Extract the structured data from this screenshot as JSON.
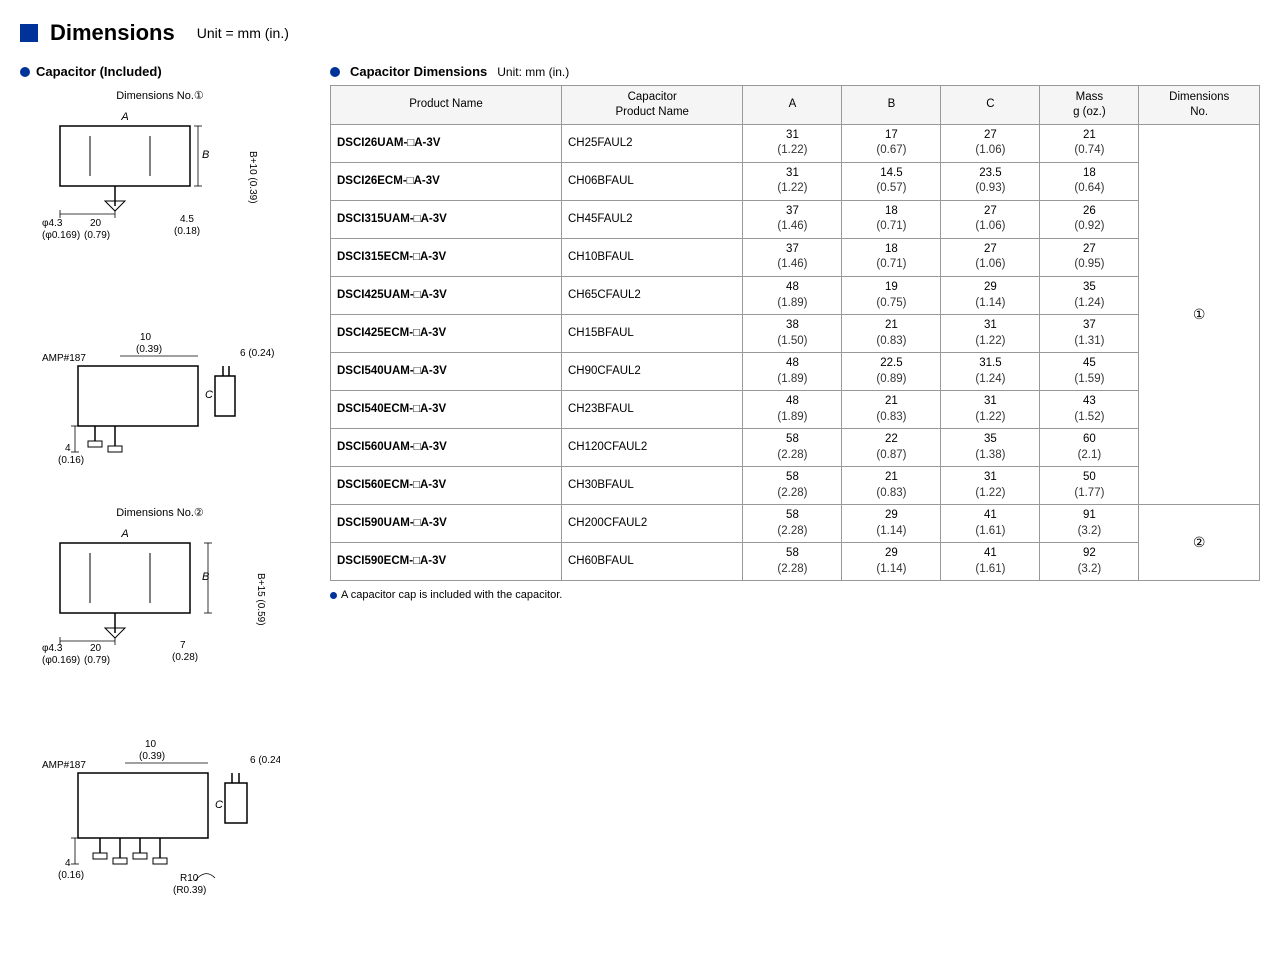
{
  "header": {
    "title": "Dimensions",
    "unit": "Unit = mm (in.)"
  },
  "left": {
    "section_title": "Capacitor (Included)",
    "dim1_label": "Dimensions No.①",
    "dim2_label": "Dimensions No.②"
  },
  "right": {
    "section_title": "Capacitor Dimensions",
    "unit": "Unit: mm (in.)",
    "columns": [
      "Product Name",
      "Capacitor\nProduct Name",
      "A",
      "B",
      "C",
      "Mass\ng (oz.)",
      "Dimensions\nNo."
    ],
    "rows": [
      {
        "product": "DSCI26UAM-□A-3V",
        "cap": "CH25FAUL2",
        "a": "31",
        "a_sub": "(1.22)",
        "b": "17",
        "b_sub": "(0.67)",
        "c": "27",
        "c_sub": "(1.06)",
        "mass": "21",
        "mass_sub": "(0.74)",
        "dim_no": ""
      },
      {
        "product": "DSCI26ECM-□A-3V",
        "cap": "CH06BFAUL",
        "a": "31",
        "a_sub": "(1.22)",
        "b": "14.5",
        "b_sub": "(0.57)",
        "c": "23.5",
        "c_sub": "(0.93)",
        "mass": "18",
        "mass_sub": "(0.64)",
        "dim_no": ""
      },
      {
        "product": "DSCI315UAM-□A-3V",
        "cap": "CH45FAUL2",
        "a": "37",
        "a_sub": "(1.46)",
        "b": "18",
        "b_sub": "(0.71)",
        "c": "27",
        "c_sub": "(1.06)",
        "mass": "26",
        "mass_sub": "(0.92)",
        "dim_no": ""
      },
      {
        "product": "DSCI315ECM-□A-3V",
        "cap": "CH10BFAUL",
        "a": "37",
        "a_sub": "(1.46)",
        "b": "18",
        "b_sub": "(0.71)",
        "c": "27",
        "c_sub": "(1.06)",
        "mass": "27",
        "mass_sub": "(0.95)",
        "dim_no": ""
      },
      {
        "product": "DSCI425UAM-□A-3V",
        "cap": "CH65CFAUL2",
        "a": "48",
        "a_sub": "(1.89)",
        "b": "19",
        "b_sub": "(0.75)",
        "c": "29",
        "c_sub": "(1.14)",
        "mass": "35",
        "mass_sub": "(1.24)",
        "dim_no": "①"
      },
      {
        "product": "DSCI425ECM-□A-3V",
        "cap": "CH15BFAUL",
        "a": "38",
        "a_sub": "(1.50)",
        "b": "21",
        "b_sub": "(0.83)",
        "c": "31",
        "c_sub": "(1.22)",
        "mass": "37",
        "mass_sub": "(1.31)",
        "dim_no": ""
      },
      {
        "product": "DSCI540UAM-□A-3V",
        "cap": "CH90CFAUL2",
        "a": "48",
        "a_sub": "(1.89)",
        "b": "22.5",
        "b_sub": "(0.89)",
        "c": "31.5",
        "c_sub": "(1.24)",
        "mass": "45",
        "mass_sub": "(1.59)",
        "dim_no": ""
      },
      {
        "product": "DSCI540ECM-□A-3V",
        "cap": "CH23BFAUL",
        "a": "48",
        "a_sub": "(1.89)",
        "b": "21",
        "b_sub": "(0.83)",
        "c": "31",
        "c_sub": "(1.22)",
        "mass": "43",
        "mass_sub": "(1.52)",
        "dim_no": ""
      },
      {
        "product": "DSCI560UAM-□A-3V",
        "cap": "CH120CFAUL2",
        "a": "58",
        "a_sub": "(2.28)",
        "b": "22",
        "b_sub": "(0.87)",
        "c": "35",
        "c_sub": "(1.38)",
        "mass": "60",
        "mass_sub": "(2.1)",
        "dim_no": ""
      },
      {
        "product": "DSCI560ECM-□A-3V",
        "cap": "CH30BFAUL",
        "a": "58",
        "a_sub": "(2.28)",
        "b": "21",
        "b_sub": "(0.83)",
        "c": "31",
        "c_sub": "(1.22)",
        "mass": "50",
        "mass_sub": "(1.77)",
        "dim_no": ""
      },
      {
        "product": "DSCI590UAM-□A-3V",
        "cap": "CH200CFAUL2",
        "a": "58",
        "a_sub": "(2.28)",
        "b": "29",
        "b_sub": "(1.14)",
        "c": "41",
        "c_sub": "(1.61)",
        "mass": "91",
        "mass_sub": "(3.2)",
        "dim_no": "②"
      },
      {
        "product": "DSCI590ECM-□A-3V",
        "cap": "CH60BFAUL",
        "a": "58",
        "a_sub": "(2.28)",
        "b": "29",
        "b_sub": "(1.14)",
        "c": "41",
        "c_sub": "(1.61)",
        "mass": "92",
        "mass_sub": "(3.2)",
        "dim_no": ""
      }
    ],
    "footnote": "A capacitor cap is included with the capacitor."
  }
}
